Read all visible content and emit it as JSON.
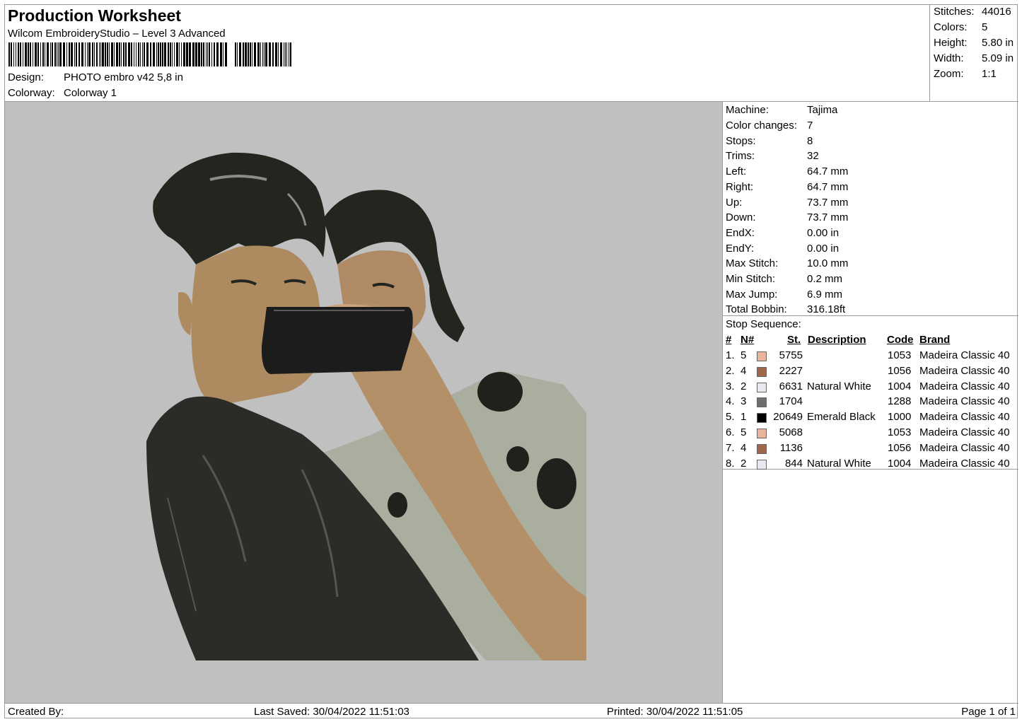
{
  "header": {
    "title": "Production Worksheet",
    "software": "Wilcom EmbroideryStudio – Level 3 Advanced",
    "design_label": "Design:",
    "design_value": "PHOTO embro v42 5,8 in",
    "colorway_label": "Colorway:",
    "colorway_value": "Colorway 1"
  },
  "summary": [
    {
      "label": "Stitches:",
      "value": "44016"
    },
    {
      "label": "Colors:",
      "value": "5"
    },
    {
      "label": "Height:",
      "value": "5.80 in"
    },
    {
      "label": "Width:",
      "value": "5.09 in"
    },
    {
      "label": "Zoom:",
      "value": "1:1"
    }
  ],
  "machine": [
    {
      "label": "Machine:",
      "value": "Tajima"
    },
    {
      "label": "Color changes:",
      "value": "7"
    },
    {
      "label": "Stops:",
      "value": "8"
    },
    {
      "label": "Trims:",
      "value": "32"
    },
    {
      "label": "Left:",
      "value": "64.7 mm"
    },
    {
      "label": "Right:",
      "value": "64.7 mm"
    },
    {
      "label": "Up:",
      "value": "73.7 mm"
    },
    {
      "label": "Down:",
      "value": "73.7 mm"
    },
    {
      "label": "EndX:",
      "value": "0.00 in"
    },
    {
      "label": "EndY:",
      "value": "0.00 in"
    },
    {
      "label": "Max Stitch:",
      "value": "10.0 mm"
    },
    {
      "label": "Min Stitch:",
      "value": "0.2 mm"
    },
    {
      "label": "Max Jump:",
      "value": "6.9 mm"
    },
    {
      "label": "Total Bobbin:",
      "value": "316.18ft"
    }
  ],
  "stop_sequence": {
    "title": "Stop Sequence:",
    "headers": {
      "num": "#",
      "n": "N#",
      "st": "St.",
      "desc": "Description",
      "code": "Code",
      "brand": "Brand"
    },
    "rows": [
      {
        "num": "1.",
        "n": "5",
        "color": "#e8b49c",
        "st": "5755",
        "desc": "",
        "code": "1053",
        "brand": "Madeira Classic 40"
      },
      {
        "num": "2.",
        "n": "4",
        "color": "#a0684a",
        "st": "2227",
        "desc": "",
        "code": "1056",
        "brand": "Madeira Classic 40"
      },
      {
        "num": "3.",
        "n": "2",
        "color": "#e8e8f0",
        "st": "6631",
        "desc": "Natural White",
        "code": "1004",
        "brand": "Madeira Classic 40"
      },
      {
        "num": "4.",
        "n": "3",
        "color": "#6e6e6e",
        "st": "1704",
        "desc": "",
        "code": "1288",
        "brand": "Madeira Classic 40"
      },
      {
        "num": "5.",
        "n": "1",
        "color": "#000000",
        "st": "20649",
        "desc": "Emerald Black",
        "code": "1000",
        "brand": "Madeira Classic 40"
      },
      {
        "num": "6.",
        "n": "5",
        "color": "#e8b49c",
        "st": "5068",
        "desc": "",
        "code": "1053",
        "brand": "Madeira Classic 40"
      },
      {
        "num": "7.",
        "n": "4",
        "color": "#a0684a",
        "st": "1136",
        "desc": "",
        "code": "1056",
        "brand": "Madeira Classic 40"
      },
      {
        "num": "8.",
        "n": "2",
        "color": "#e8e8f0",
        "st": "844",
        "desc": "Natural White",
        "code": "1004",
        "brand": "Madeira Classic 40"
      }
    ]
  },
  "footer": {
    "created_by": "Created By:",
    "last_saved": "Last Saved: 30/04/2022 11:51:03",
    "printed": "Printed: 30/04/2022 11:51:05",
    "page": "Page 1 of 1"
  }
}
